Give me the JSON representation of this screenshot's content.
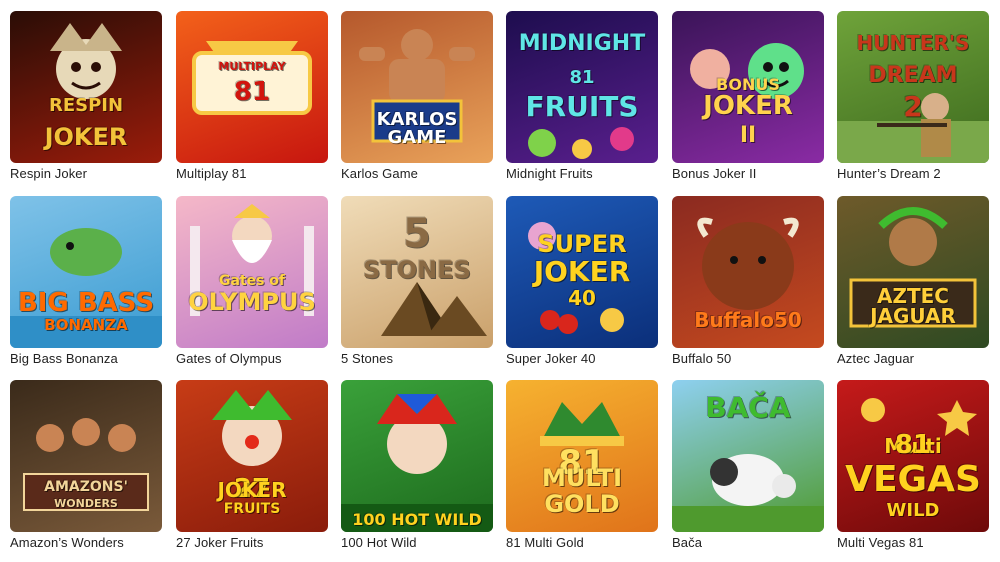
{
  "games": [
    {
      "id": "respin-joker",
      "title": "Respin Joker",
      "thumb_lines": [
        "RESPIN",
        "JOKER"
      ],
      "colors": {
        "bg1": "#2a0d06",
        "bg2": "#9b1c0b",
        "text": "#f3c33a"
      },
      "icon": "jester-mask-icon"
    },
    {
      "id": "multiplay-81",
      "title": "Multiplay 81",
      "thumb_lines": [
        "MULTIPLAY",
        "81"
      ],
      "colors": {
        "bg1": "#f3611a",
        "bg2": "#c7160f",
        "text": "#d2140e"
      },
      "icon": "vegas-sign-icon"
    },
    {
      "id": "karlos-game",
      "title": "Karlos Game",
      "thumb_lines": [
        "KARLOS",
        "GAME"
      ],
      "colors": {
        "bg1": "#b5582c",
        "bg2": "#e9a25a",
        "text": "#ffffff"
      },
      "icon": "strongman-icon"
    },
    {
      "id": "midnight-fruits",
      "title": "Midnight Fruits",
      "thumb_lines": [
        "MIDNIGHT",
        "81",
        "FRUITS"
      ],
      "colors": {
        "bg1": "#1d0d4e",
        "bg2": "#5a1f8e",
        "text": "#5fe6e6"
      },
      "icon": "neon-sign-icon"
    },
    {
      "id": "bonus-joker-2",
      "title": "Bonus Joker II",
      "thumb_lines": [
        "BONUS",
        "JOKER",
        "II"
      ],
      "colors": {
        "bg1": "#3a1458",
        "bg2": "#8a2ba4",
        "text": "#ffd34d"
      },
      "icon": "joker-face-icon"
    },
    {
      "id": "hunters-dream-2",
      "title": "Hunter’s Dream 2",
      "thumb_lines": [
        "HUNTER'S",
        "DREAM",
        "2"
      ],
      "colors": {
        "bg1": "#6fa33a",
        "bg2": "#3d6a1e",
        "text": "#c8361b"
      },
      "icon": "hunter-icon"
    },
    {
      "id": "big-bass-bonanza",
      "title": "Big Bass Bonanza",
      "thumb_lines": [
        "BIG BASS",
        "BONANZA"
      ],
      "colors": {
        "bg1": "#7fc2e8",
        "bg2": "#3a9bd1",
        "text": "#ff6a00"
      },
      "icon": "fish-icon"
    },
    {
      "id": "gates-of-olympus",
      "title": "Gates of Olympus",
      "thumb_lines": [
        "Gates of",
        "OLYMPUS"
      ],
      "colors": {
        "bg1": "#f5b8c8",
        "bg2": "#c07bc8",
        "text": "#ffd340"
      },
      "icon": "zeus-icon"
    },
    {
      "id": "5-stones",
      "title": "5 Stones",
      "thumb_lines": [
        "5",
        "STONES"
      ],
      "colors": {
        "bg1": "#f0dcb8",
        "bg2": "#caa06a",
        "text": "#8a6a44"
      },
      "icon": "pyramid-icon"
    },
    {
      "id": "super-joker-40",
      "title": "Super Joker 40",
      "thumb_lines": [
        "SUPER",
        "JOKER",
        "40"
      ],
      "colors": {
        "bg1": "#1e5ab7",
        "bg2": "#0b2f7a",
        "text": "#ffd21f"
      },
      "icon": "cherries-icon"
    },
    {
      "id": "buffalo-50",
      "title": "Buffalo 50",
      "thumb_lines": [
        "Buffalo50"
      ],
      "colors": {
        "bg1": "#8b2a20",
        "bg2": "#c54a1f",
        "text": "#ff7a1a"
      },
      "icon": "buffalo-icon"
    },
    {
      "id": "aztec-jaguar",
      "title": "Aztec Jaguar",
      "thumb_lines": [
        "AZTEC",
        "JAGUAR"
      ],
      "colors": {
        "bg1": "#6e5a2a",
        "bg2": "#2e4a22",
        "text": "#ffcf3a"
      },
      "icon": "aztec-warrior-icon"
    },
    {
      "id": "amazons-wonders",
      "title": "Amazon’s Wonders",
      "thumb_lines": [
        "AMAZONS'",
        "WONDERS"
      ],
      "colors": {
        "bg1": "#3a2a1a",
        "bg2": "#7a5a3a",
        "text": "#f2d59a"
      },
      "icon": "warriors-icon"
    },
    {
      "id": "27-joker-fruits",
      "title": "27 Joker Fruits",
      "thumb_lines": [
        "27",
        "JOKER",
        "FRUITS"
      ],
      "colors": {
        "bg1": "#c73c16",
        "bg2": "#8a1c0b",
        "text": "#ffd21f"
      },
      "icon": "clown-icon"
    },
    {
      "id": "100-hot-wild",
      "title": "100 Hot Wild",
      "thumb_lines": [
        "100 HOT WILD"
      ],
      "colors": {
        "bg1": "#3aa13a",
        "bg2": "#1d6a1d",
        "text": "#ffd21f"
      },
      "icon": "jester-icon"
    },
    {
      "id": "81-multi-gold",
      "title": "81 Multi Gold",
      "thumb_lines": [
        "81",
        "MULTI",
        "GOLD"
      ],
      "colors": {
        "bg1": "#f6b230",
        "bg2": "#e0731a",
        "text": "#ffe060"
      },
      "icon": "jester-hat-icon"
    },
    {
      "id": "baca",
      "title": "Bača",
      "thumb_lines": [
        "BAČA"
      ],
      "colors": {
        "bg1": "#8ed0f0",
        "bg2": "#4f9a2e",
        "text": "#3fbb2f"
      },
      "icon": "sheep-icon"
    },
    {
      "id": "multi-vegas-81",
      "title": "Multi Vegas 81",
      "thumb_lines": [
        "Multi",
        "81",
        "VEGAS",
        "WILD"
      ],
      "colors": {
        "bg1": "#c51a1a",
        "bg2": "#6e0a0a",
        "text": "#ffd21f"
      },
      "icon": "bell-icon"
    }
  ]
}
